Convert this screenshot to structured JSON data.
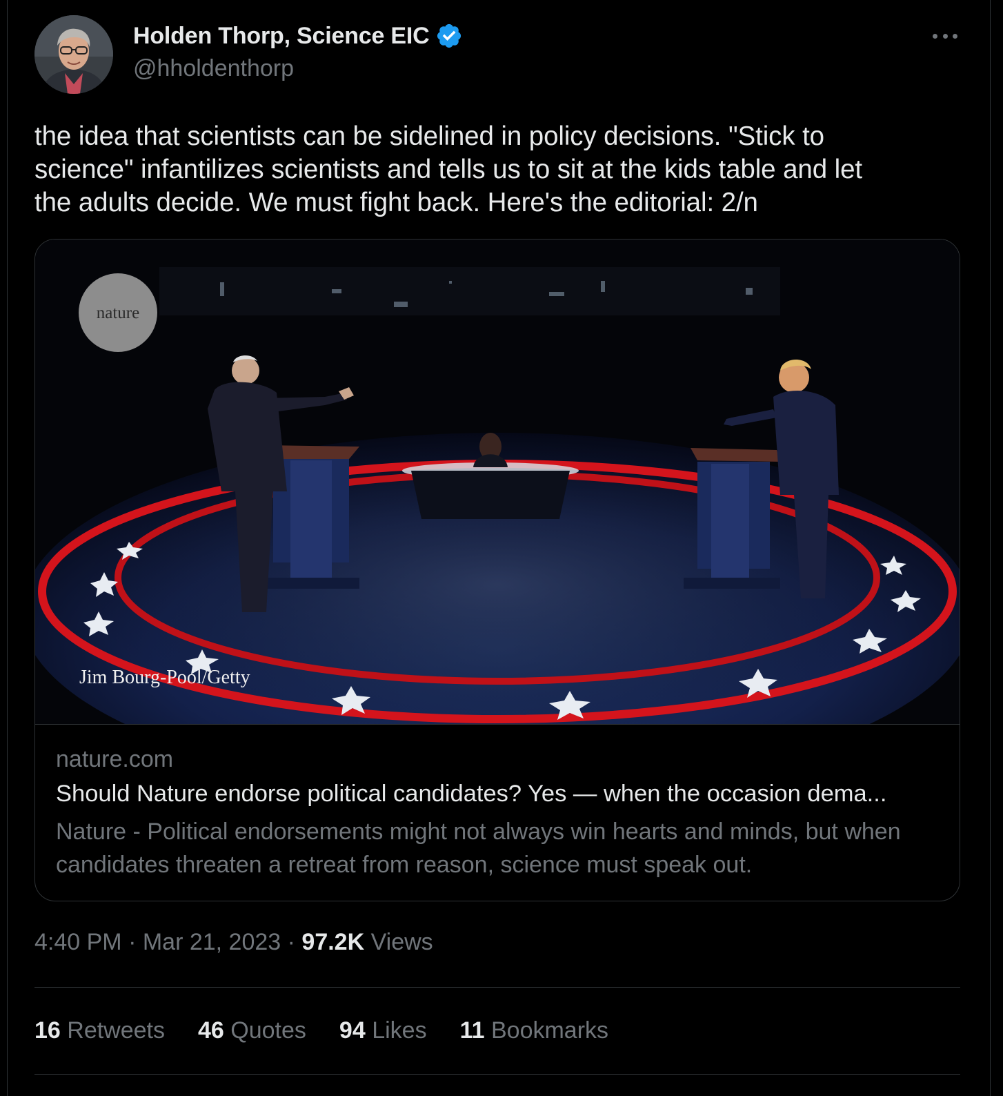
{
  "author": {
    "name": "Holden Thorp, Science EIC",
    "handle": "@hholdenthorp",
    "verified": true
  },
  "tweet": {
    "text": "the idea that scientists can be sidelined in policy decisions. \"Stick to\nscience\" infantilizes scientists and tells us to sit at the kids table and let\nthe adults decide.  We must fight back. Here's the editorial: 2/n"
  },
  "card": {
    "image_logo": "nature",
    "image_credit": "Jim Bourg-Pool/Getty",
    "domain": "nature.com",
    "title": "Should Nature endorse political candidates? Yes — when the occasion dema...",
    "description": "Nature - Political endorsements might not always win hearts and minds, but when candidates threaten a retreat from reason, science must speak out."
  },
  "meta": {
    "time": "4:40 PM",
    "sep1": " · ",
    "date": "Mar 21, 2023",
    "sep2": " · ",
    "views_count": "97.2K",
    "views_label": " Views"
  },
  "stats": [
    {
      "count": "16",
      "label": " Retweets"
    },
    {
      "count": "46",
      "label": " Quotes"
    },
    {
      "count": "94",
      "label": " Likes"
    },
    {
      "count": "11",
      "label": " Bookmarks"
    }
  ],
  "icons": {
    "verified": "verified-badge-icon",
    "more": "more-horizontal-icon"
  },
  "colors": {
    "background": "#000000",
    "primary_text": "#e7e9ea",
    "secondary_text": "#71767b",
    "border": "#2f3336",
    "verified_blue": "#1d9bf0",
    "stage_red": "#d4141c",
    "stage_blue": "#1a2a55"
  }
}
